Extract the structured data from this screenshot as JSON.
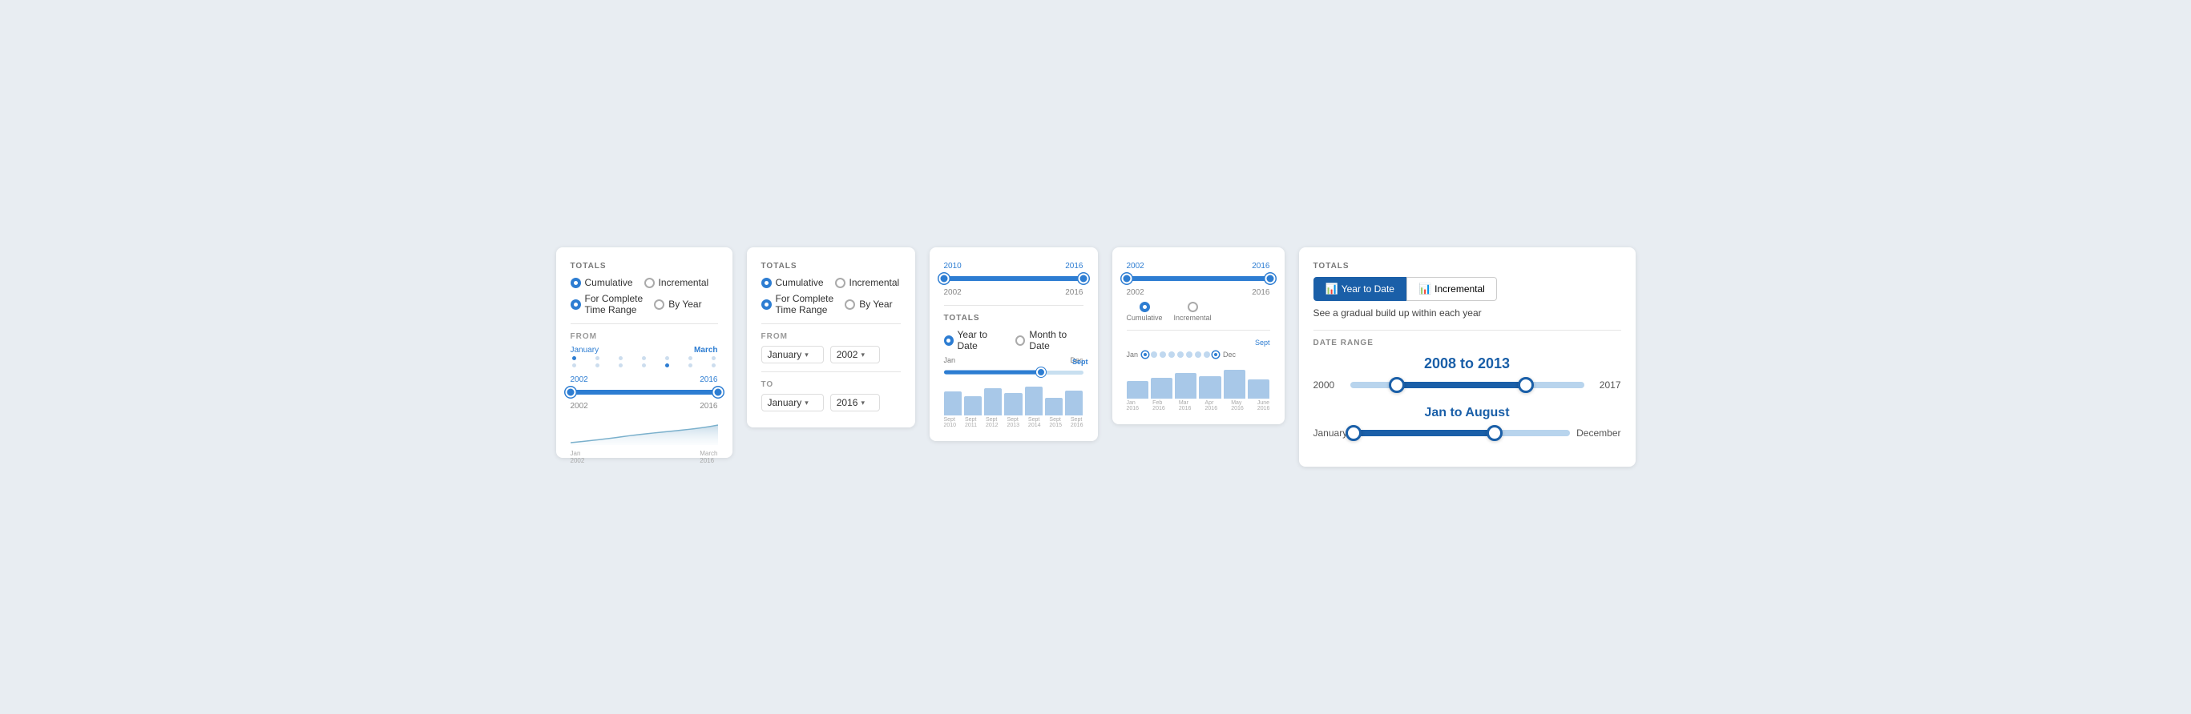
{
  "card1": {
    "totals_label": "TOTALS",
    "cumulative": "Cumulative",
    "incremental": "Incremental",
    "for_complete": "For Complete",
    "time_range": "Time Range",
    "by_year": "By Year",
    "from_label": "FROM",
    "from_start": "January",
    "from_end": "March",
    "year_start": "2002",
    "year_end": "2016",
    "year_label_left": "2002",
    "year_label_right": "2016",
    "x_label_left": "Jan\n2002",
    "x_label_right": "March\n2016"
  },
  "card2": {
    "totals_label": "TOTALS",
    "cumulative": "Cumulative",
    "incremental": "Incremental",
    "for_complete": "For Complete",
    "time_range": "Time Range",
    "by_year": "By Year",
    "from_label": "FROM",
    "from_select1": "January",
    "from_select2": "2002",
    "to_label": "TO",
    "to_select1": "January",
    "to_select2": "2016"
  },
  "card3": {
    "year_start": "2002",
    "year_end": "2016",
    "year_top_left": "2010",
    "year_top_right": "2016",
    "totals_label": "TOTALS",
    "year_to_date": "Year to Date",
    "month_to_date": "Month to Date",
    "month_start": "Jan",
    "month_end": "Dec",
    "month_marker": "Sept",
    "bar_labels": [
      "Sept\n2010",
      "Sept\n2011",
      "Sept\n2012",
      "Sept\n2013",
      "Sept\n2014",
      "Sept\n2015",
      "Sept\n2016"
    ],
    "bar_heights": [
      30,
      25,
      32,
      28,
      35,
      22,
      30
    ]
  },
  "card4": {
    "year_start": "2002",
    "year_end": "2016",
    "year_top_left": "2002",
    "year_top_right": "2016",
    "cumulative_label": "Cumulative",
    "incremental_label": "Incremental",
    "month_start": "Jan",
    "month_end": "Dec",
    "month_marker": "Sept",
    "bar_labels": [
      "Jan\n2016",
      "Feb\n2016",
      "Mar\n2016",
      "Apr\n2016",
      "May\n2016",
      "June\n2016"
    ],
    "bar_heights": [
      18,
      22,
      28,
      25,
      32,
      20
    ]
  },
  "card5": {
    "totals_label": "TOTALS",
    "year_to_date_btn": "Year to Date",
    "incremental_btn": "Incremental",
    "desc": "See a gradual build up within each year",
    "date_range_label": "DATE RANGE",
    "year_range_title": "2008 to 2013",
    "year_left": "2000",
    "year_right": "2017",
    "month_range_title": "Jan to August",
    "month_left": "January",
    "month_right": "December"
  }
}
